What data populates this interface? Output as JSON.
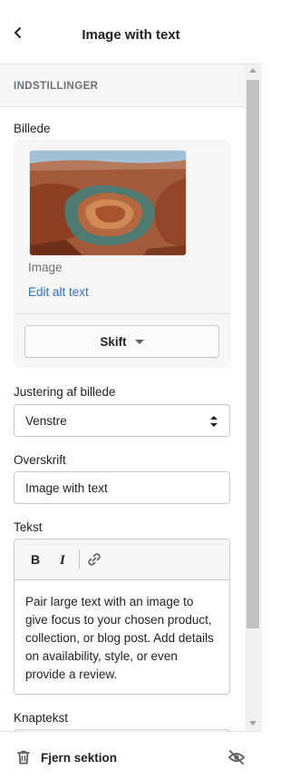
{
  "header": {
    "title": "Image with text"
  },
  "section": {
    "heading": "INDSTILLINGER"
  },
  "image_setting": {
    "label": "Billede",
    "caption": "Image",
    "edit_alt_link": "Edit alt text",
    "change_button": "Skift"
  },
  "alignment": {
    "label": "Justering af billede",
    "selected": "Venstre"
  },
  "heading_field": {
    "label": "Overskrift",
    "value": "Image with text"
  },
  "text_field": {
    "label": "Tekst",
    "body": "Pair large text with an image to give focus to your chosen product, collection, or blog post. Add details on availability, style, or even provide a review."
  },
  "button_text": {
    "label": "Knaptekst"
  },
  "footer": {
    "remove_label": "Fjern sektion"
  },
  "colors": {
    "link": "#2c6ecb",
    "text": "#202223",
    "muted": "#6d7175",
    "surface_subdued": "#f6f6f7",
    "border": "#c9cccf"
  }
}
